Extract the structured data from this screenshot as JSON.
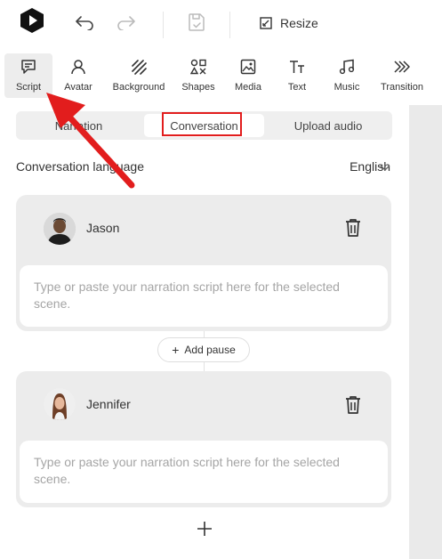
{
  "topbar": {
    "resize_label": "Resize"
  },
  "toolbar": {
    "items": [
      {
        "label": "Script"
      },
      {
        "label": "Avatar"
      },
      {
        "label": "Background"
      },
      {
        "label": "Shapes"
      },
      {
        "label": "Media"
      },
      {
        "label": "Text"
      },
      {
        "label": "Music"
      },
      {
        "label": "Transition"
      }
    ]
  },
  "tabs": [
    {
      "label": "Narration"
    },
    {
      "label": "Conversation"
    },
    {
      "label": "Upload audio"
    }
  ],
  "language": {
    "label": "Conversation language",
    "value": "English"
  },
  "speakers": [
    {
      "name": "Jason",
      "placeholder": "Type or paste your narration script here for the selected scene."
    },
    {
      "name": "Jennifer",
      "placeholder": "Type or paste your narration script here for the selected scene."
    }
  ],
  "add_pause_label": "Add pause",
  "colors": {
    "highlight": "#e21d1d",
    "arrow": "#e21d1d"
  }
}
